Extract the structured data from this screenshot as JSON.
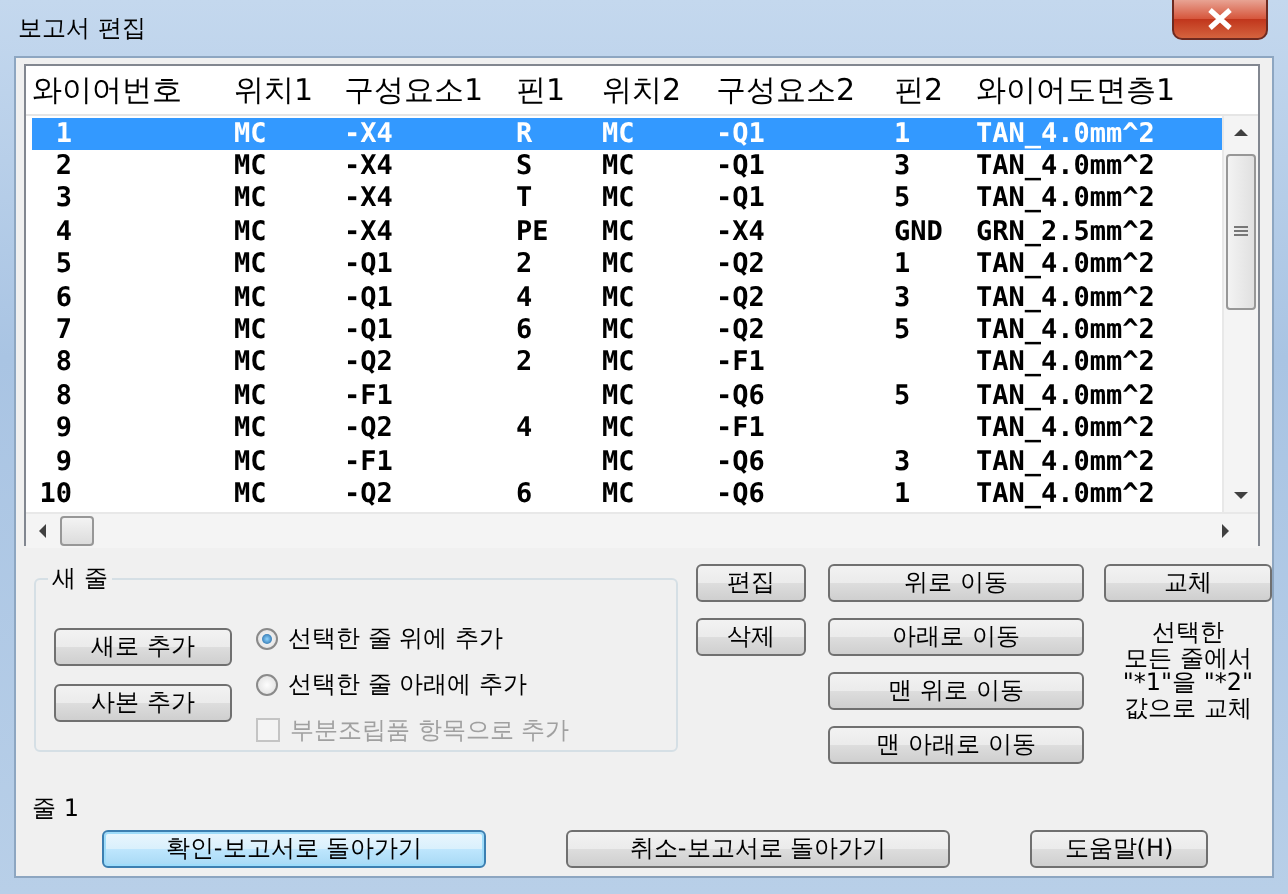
{
  "window": {
    "title": "보고서 편집"
  },
  "table": {
    "columns": [
      "와이어번호",
      "위치1",
      "구성요소1",
      "핀1",
      "위치2",
      "구성요소2",
      "핀2",
      "와이어도면층1"
    ],
    "rows": [
      {
        "cells": [
          "1",
          "MC",
          "-X4",
          "R",
          "MC",
          "-Q1",
          "1",
          "TAN_4.0mm^2"
        ],
        "selected": true
      },
      {
        "cells": [
          "2",
          "MC",
          "-X4",
          "S",
          "MC",
          "-Q1",
          "3",
          "TAN_4.0mm^2"
        ],
        "selected": false
      },
      {
        "cells": [
          "3",
          "MC",
          "-X4",
          "T",
          "MC",
          "-Q1",
          "5",
          "TAN_4.0mm^2"
        ],
        "selected": false
      },
      {
        "cells": [
          "4",
          "MC",
          "-X4",
          "PE",
          "MC",
          "-X4",
          "GND",
          "GRN_2.5mm^2"
        ],
        "selected": false
      },
      {
        "cells": [
          "5",
          "MC",
          "-Q1",
          "2",
          "MC",
          "-Q2",
          "1",
          "TAN_4.0mm^2"
        ],
        "selected": false
      },
      {
        "cells": [
          "6",
          "MC",
          "-Q1",
          "4",
          "MC",
          "-Q2",
          "3",
          "TAN_4.0mm^2"
        ],
        "selected": false
      },
      {
        "cells": [
          "7",
          "MC",
          "-Q1",
          "6",
          "MC",
          "-Q2",
          "5",
          "TAN_4.0mm^2"
        ],
        "selected": false
      },
      {
        "cells": [
          "8",
          "MC",
          "-Q2",
          "2",
          "MC",
          "-F1",
          null,
          "TAN_4.0mm^2"
        ],
        "selected": false
      },
      {
        "cells": [
          "8",
          "MC",
          "-F1",
          null,
          "MC",
          "-Q6",
          "5",
          "TAN_4.0mm^2"
        ],
        "selected": false
      },
      {
        "cells": [
          "9",
          "MC",
          "-Q2",
          "4",
          "MC",
          "-F1",
          null,
          "TAN_4.0mm^2"
        ],
        "selected": false
      },
      {
        "cells": [
          "9",
          "MC",
          "-F1",
          null,
          "MC",
          "-Q6",
          "3",
          "TAN_4.0mm^2"
        ],
        "selected": false
      },
      {
        "cells": [
          "10",
          "MC",
          "-Q2",
          "6",
          "MC",
          "-Q6",
          "1",
          "TAN_4.0mm^2"
        ],
        "selected": false
      }
    ]
  },
  "new_row": {
    "title": "새 줄",
    "buttons": [
      "새로 추가",
      "사본 추가"
    ],
    "options": [
      {
        "kind": "radio",
        "label": "선택한 줄 위에 추가",
        "selected": true,
        "disabled": false
      },
      {
        "kind": "radio",
        "label": "선택한 줄 아래에 추가",
        "selected": false,
        "disabled": false
      },
      {
        "kind": "checkbox",
        "label": "부분조립품 항목으로 추가",
        "checked": false,
        "disabled": true
      }
    ]
  },
  "edit_buttons": [
    "편집",
    "삭제"
  ],
  "move_buttons": [
    "위로 이동",
    "아래로 이동",
    "맨 위로 이동",
    "맨 아래로 이동"
  ],
  "replace": {
    "button": "교체",
    "note": "선택한\n모든 줄에서\n\"*1\"을 \"*2\"\n값으로 교체"
  },
  "status": "줄 1",
  "footer_buttons": [
    {
      "label": "확인-보고서로 돌아가기",
      "default": true
    },
    {
      "label": "취소-보고서로 돌아가기",
      "default": false
    },
    {
      "label": "도움말(H)",
      "default": false
    }
  ]
}
